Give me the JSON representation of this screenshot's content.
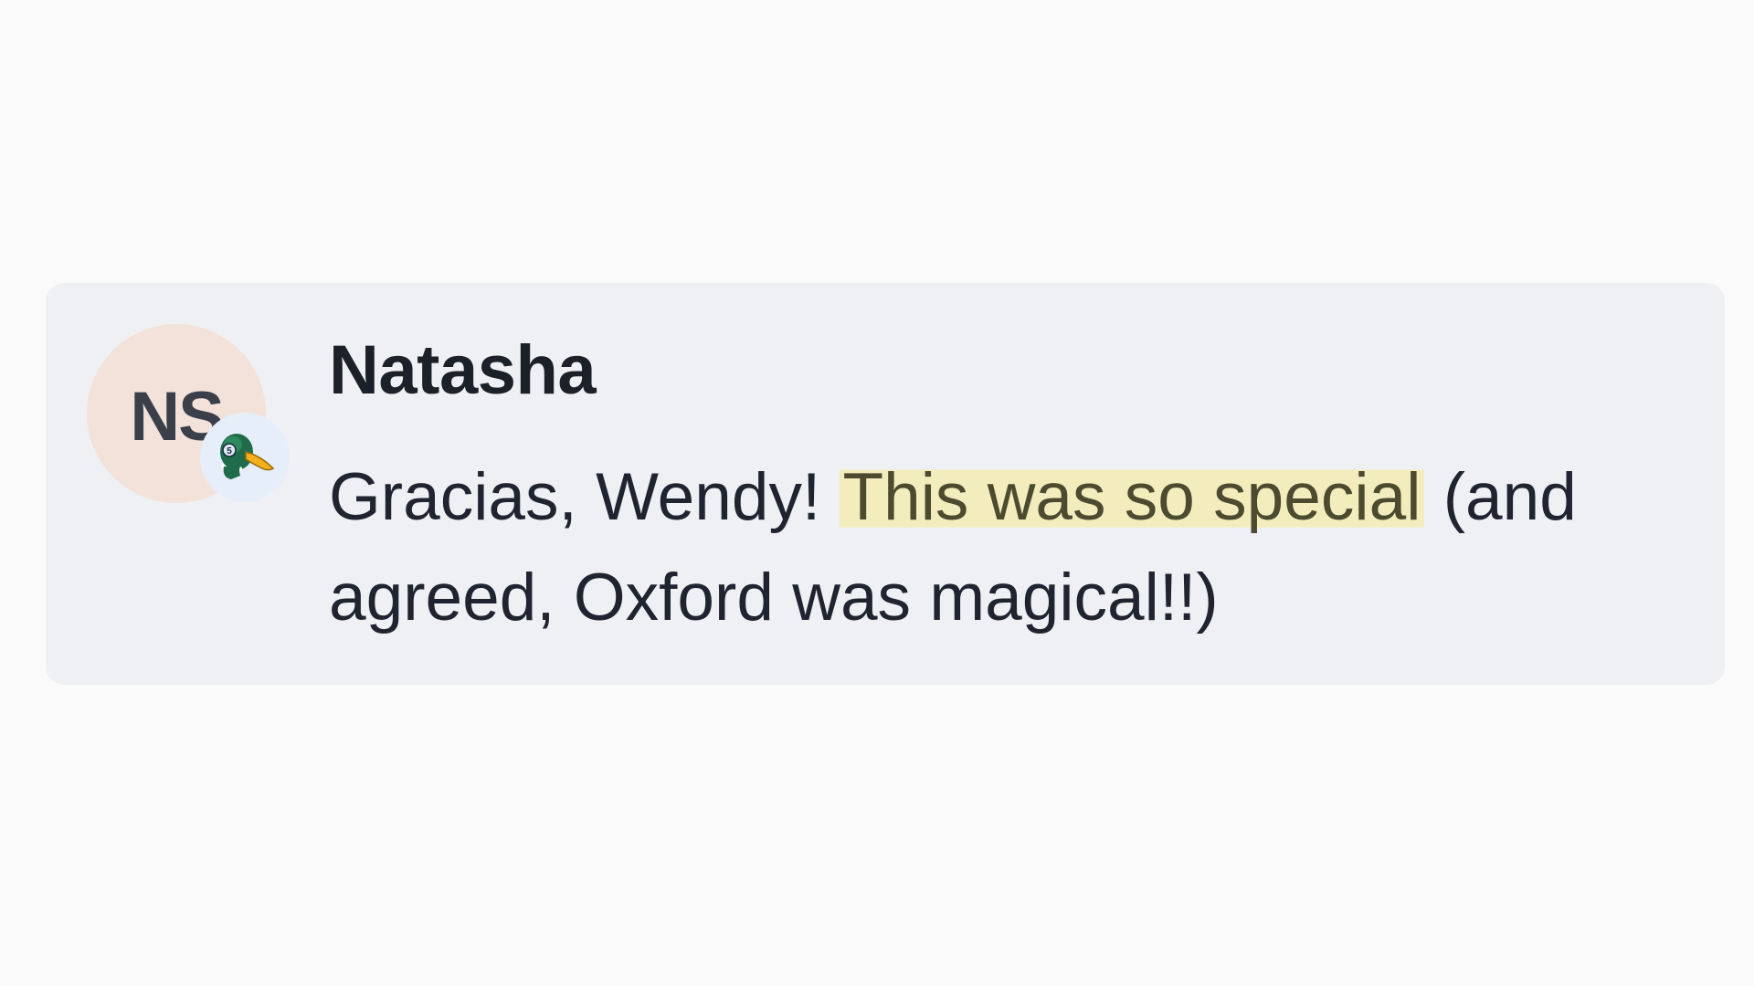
{
  "comment": {
    "avatar_initials": "NS",
    "badge_icon": "duck-icon",
    "author": "Natasha",
    "message_before": "Gracias, Wendy! ",
    "message_highlight": "This was so special",
    "message_after": " (and agreed, Oxford was magical!!)"
  },
  "colors": {
    "card_background": "#eff0f4",
    "avatar_background": "#f2e2da",
    "badge_background": "#e6eef9",
    "highlight": "#f3edbd"
  }
}
